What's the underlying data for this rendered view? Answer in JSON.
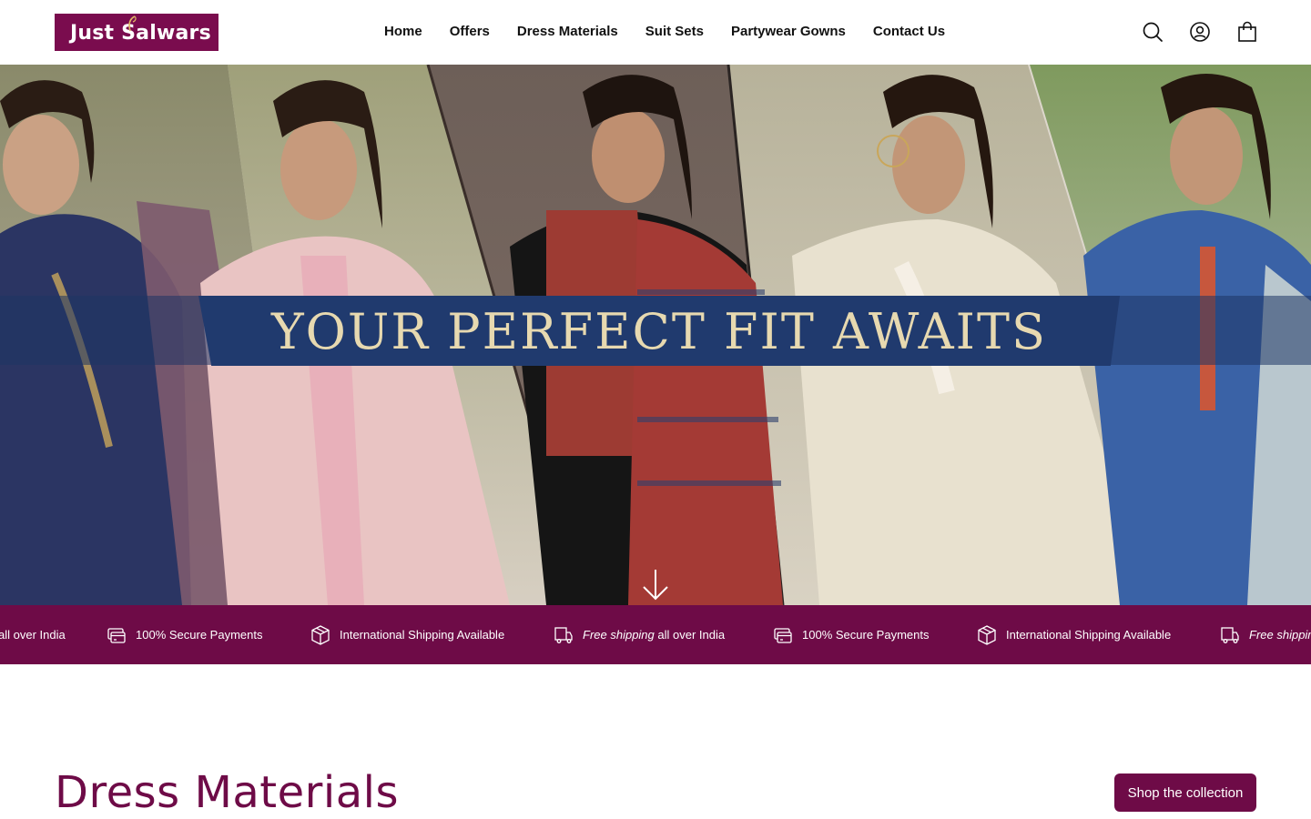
{
  "brand": {
    "logo_text": "Just Salwars",
    "logo_bg": "#7a0c4e"
  },
  "nav": {
    "items": [
      "Home",
      "Offers",
      "Dress Materials",
      "Suit Sets",
      "Partywear Gowns",
      "Contact Us"
    ]
  },
  "header_icons": [
    "search-icon",
    "account-icon",
    "cart-icon"
  ],
  "hero": {
    "banner_text": "YOUR PERFECT FIT AWAITS",
    "banner_color": "#203a6e",
    "banner_text_color": "#e7d9b0",
    "scroll_icon": "arrow-down-icon"
  },
  "marquee": {
    "bg_color": "#6e0b47",
    "items": [
      {
        "icon": "truck-icon",
        "emph": "",
        "text": "all over India"
      },
      {
        "icon": "card-icon",
        "emph": "",
        "text": "100% Secure Payments"
      },
      {
        "icon": "box-icon",
        "emph": "",
        "text": "International Shipping Available"
      },
      {
        "icon": "truck-icon",
        "emph": "Free shipping",
        "text": " all over India"
      },
      {
        "icon": "card-icon",
        "emph": "",
        "text": "100% Secure Payments"
      },
      {
        "icon": "box-icon",
        "emph": "",
        "text": "International Shipping Available"
      },
      {
        "icon": "truck-icon",
        "emph": "Free shippin",
        "text": ""
      }
    ]
  },
  "section": {
    "title": "Dress Materials",
    "button_label": "Shop the collection",
    "accent": "#6e0b47"
  }
}
